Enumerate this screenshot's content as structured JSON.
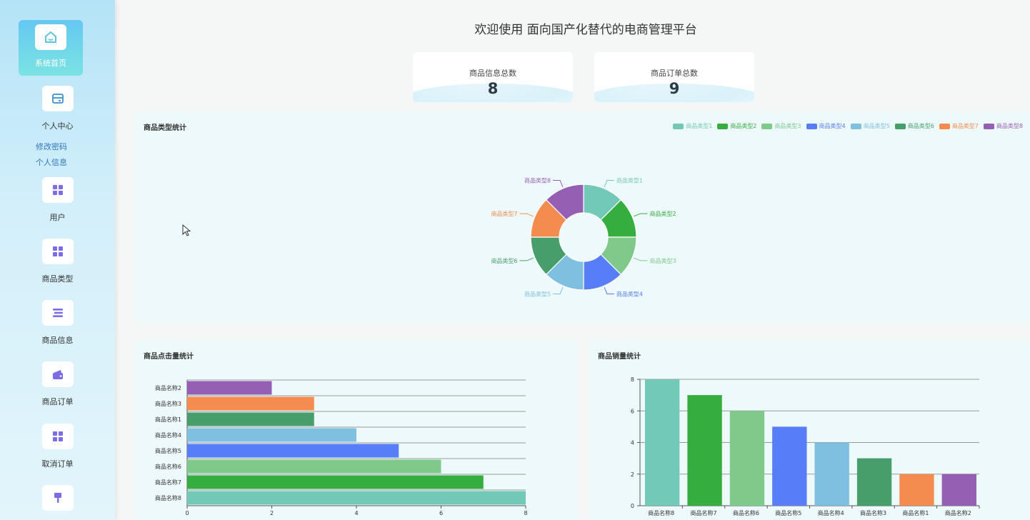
{
  "header": {
    "title": "欢迎使用 面向国产化替代的电商管理平台"
  },
  "sidebar": {
    "items": [
      {
        "label": "系统首页",
        "icon": "home-icon"
      },
      {
        "label": "个人中心",
        "icon": "wallet-icon"
      },
      {
        "label": "用户",
        "icon": "grid-icon"
      },
      {
        "label": "商品类型",
        "icon": "grid-icon"
      },
      {
        "label": "商品信息",
        "icon": "list-icon"
      },
      {
        "label": "商品订单",
        "icon": "purse-icon"
      },
      {
        "label": "取消订单",
        "icon": "grid-icon"
      },
      {
        "label": "",
        "icon": "brush-icon"
      }
    ],
    "subitems": [
      {
        "label": "修改密码"
      },
      {
        "label": "个人信息"
      }
    ]
  },
  "stats": [
    {
      "label": "商品信息总数",
      "value": "8"
    },
    {
      "label": "商品订单总数",
      "value": "9"
    }
  ],
  "colors": [
    "#73c9b7",
    "#36ae3f",
    "#7fc98b",
    "#587ef7",
    "#7fbfdf",
    "#479e6b",
    "#f48b4f",
    "#955fb4"
  ],
  "chart_data": [
    {
      "type": "pie",
      "title": "商品类型统计",
      "categories": [
        "商品类型1",
        "商品类型2",
        "商品类型3",
        "商品类型4",
        "商品类型5",
        "商品类型6",
        "商品类型7",
        "商品类型8"
      ],
      "values": [
        1,
        1,
        1,
        1,
        1,
        1,
        1,
        1
      ],
      "legend": "top-right"
    },
    {
      "type": "bar",
      "orientation": "horizontal",
      "title": "商品点击量统计",
      "categories": [
        "商品名称2",
        "商品名称3",
        "商品名称1",
        "商品名称4",
        "商品名称5",
        "商品名称6",
        "商品名称7",
        "商品名称8"
      ],
      "values": [
        2,
        3,
        3,
        4,
        5,
        6,
        7,
        8
      ],
      "xlim": [
        0,
        8
      ],
      "ticks": [
        "0",
        "2",
        "4",
        "6",
        "8"
      ],
      "grid": true
    },
    {
      "type": "bar",
      "title": "商品销量统计",
      "categories": [
        "商品名称8",
        "商品名称7",
        "商品名称6",
        "商品名称5",
        "商品名称4",
        "商品名称3",
        "商品名称1",
        "商品名称2"
      ],
      "values": [
        8,
        7,
        6,
        5,
        4,
        3,
        2,
        2
      ],
      "ylim": [
        0,
        8
      ],
      "ticks": [
        "0",
        "2",
        "4",
        "6",
        "8"
      ],
      "grid": true
    }
  ]
}
